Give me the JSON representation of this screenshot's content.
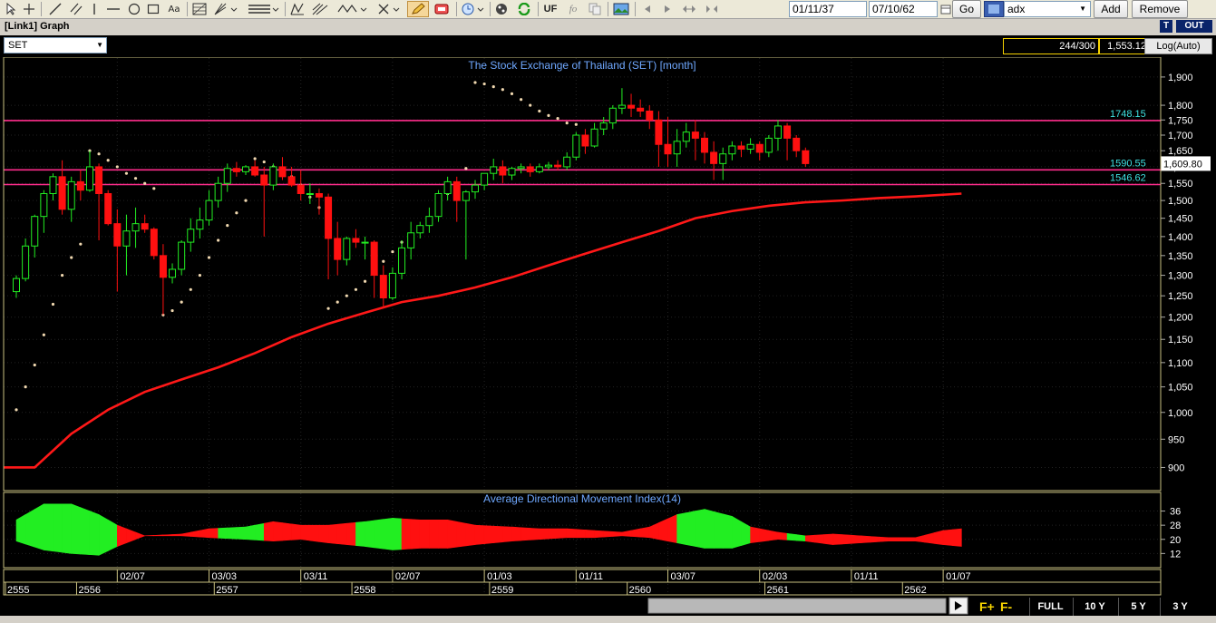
{
  "toolbar": {
    "icons": [
      "cursor-icon",
      "crosshair-icon",
      "trendline-icon",
      "parallel-lines-icon",
      "vertical-line-icon",
      "horizontal-line-icon",
      "circle-icon",
      "rectangle-icon",
      "text-tool-icon",
      "fibonacci-icon",
      "gann-icon",
      "zigzag-icon",
      "delete-icon",
      "pencil-icon",
      "eraser-icon",
      "clock-icon",
      "palette-icon",
      "refresh-icon",
      "formula-icon",
      "image-icon",
      "nav-left-icon",
      "nav-right-icon",
      "expand-icon",
      "shrink-icon"
    ],
    "uf_label": "UF",
    "fo_label": "fo",
    "start_date": "01/11/37",
    "end_date": "07/10/62",
    "go_label": "Go",
    "indicator_value": "adx",
    "add_label": "Add",
    "remove_label": "Remove"
  },
  "window": {
    "title": "[Link1] Graph",
    "t_label": "T",
    "out_label": "OUT"
  },
  "info": {
    "symbol": "SET",
    "count": "244/300",
    "price": "1,553.12",
    "scale_mode": "Log(Auto)"
  },
  "chart_data": {
    "type": "candlestick",
    "title": "The Stock Exchange of Thailand (SET) [month]",
    "yscale": "log",
    "ylim": [
      870,
      1960
    ],
    "y_ticks": [
      900,
      950,
      1000,
      1050,
      1100,
      1150,
      1200,
      1250,
      1300,
      1350,
      1400,
      1450,
      1500,
      1550,
      1600,
      1650,
      1700,
      1750,
      1800,
      1900
    ],
    "horizontal_lines": [
      {
        "value": 1748.15,
        "label": "1748.15",
        "color": "#ff2d8c"
      },
      {
        "value": 1590.55,
        "label": "1590.55",
        "color": "#ff2d8c"
      },
      {
        "value": 1546.62,
        "label": "1546.62",
        "color": "#ff2d8c"
      }
    ],
    "last_price_label": "1,609.80",
    "last_price_value": 1609.8,
    "x_month_labels": [
      "02/07",
      "03/03",
      "03/11",
      "02/07",
      "01/03",
      "01/11",
      "03/07",
      "02/03",
      "01/11",
      "01/07"
    ],
    "x_month_index": [
      11,
      21,
      31,
      41,
      51,
      61,
      71,
      81,
      91,
      101
    ],
    "x_year_labels": [
      "2555",
      "2556",
      "2557",
      "2558",
      "2559",
      "2560",
      "2561",
      "2562"
    ],
    "x_year_index": [
      0,
      4,
      19,
      34,
      49,
      64,
      79,
      94
    ],
    "candles": [
      {
        "o": 1260,
        "h": 1300,
        "l": 1245,
        "c": 1292
      },
      {
        "o": 1292,
        "h": 1395,
        "l": 1285,
        "c": 1375
      },
      {
        "o": 1375,
        "h": 1460,
        "l": 1345,
        "c": 1455
      },
      {
        "o": 1455,
        "h": 1530,
        "l": 1410,
        "c": 1520
      },
      {
        "o": 1520,
        "h": 1580,
        "l": 1500,
        "c": 1570
      },
      {
        "o": 1570,
        "h": 1620,
        "l": 1460,
        "c": 1475
      },
      {
        "o": 1475,
        "h": 1570,
        "l": 1440,
        "c": 1555
      },
      {
        "o": 1555,
        "h": 1590,
        "l": 1500,
        "c": 1530
      },
      {
        "o": 1530,
        "h": 1650,
        "l": 1525,
        "c": 1600
      },
      {
        "o": 1600,
        "h": 1610,
        "l": 1390,
        "c": 1520
      },
      {
        "o": 1520,
        "h": 1530,
        "l": 1430,
        "c": 1435
      },
      {
        "o": 1435,
        "h": 1475,
        "l": 1260,
        "c": 1375
      },
      {
        "o": 1375,
        "h": 1460,
        "l": 1300,
        "c": 1415
      },
      {
        "o": 1415,
        "h": 1480,
        "l": 1370,
        "c": 1435
      },
      {
        "o": 1435,
        "h": 1460,
        "l": 1410,
        "c": 1420
      },
      {
        "o": 1420,
        "h": 1425,
        "l": 1340,
        "c": 1350
      },
      {
        "o": 1350,
        "h": 1380,
        "l": 1205,
        "c": 1295
      },
      {
        "o": 1295,
        "h": 1330,
        "l": 1280,
        "c": 1315
      },
      {
        "o": 1315,
        "h": 1390,
        "l": 1300,
        "c": 1385
      },
      {
        "o": 1385,
        "h": 1450,
        "l": 1360,
        "c": 1420
      },
      {
        "o": 1420,
        "h": 1480,
        "l": 1395,
        "c": 1445
      },
      {
        "o": 1445,
        "h": 1530,
        "l": 1430,
        "c": 1500
      },
      {
        "o": 1500,
        "h": 1570,
        "l": 1480,
        "c": 1550
      },
      {
        "o": 1550,
        "h": 1610,
        "l": 1525,
        "c": 1595
      },
      {
        "o": 1595,
        "h": 1615,
        "l": 1570,
        "c": 1585
      },
      {
        "o": 1585,
        "h": 1605,
        "l": 1575,
        "c": 1600
      },
      {
        "o": 1600,
        "h": 1620,
        "l": 1570,
        "c": 1575
      },
      {
        "o": 1575,
        "h": 1600,
        "l": 1400,
        "c": 1545
      },
      {
        "o": 1545,
        "h": 1610,
        "l": 1530,
        "c": 1600
      },
      {
        "o": 1600,
        "h": 1630,
        "l": 1560,
        "c": 1570
      },
      {
        "o": 1570,
        "h": 1600,
        "l": 1540,
        "c": 1545
      },
      {
        "o": 1545,
        "h": 1590,
        "l": 1500,
        "c": 1520
      },
      {
        "o": 1520,
        "h": 1550,
        "l": 1490,
        "c": 1520
      },
      {
        "o": 1520,
        "h": 1535,
        "l": 1460,
        "c": 1510
      },
      {
        "o": 1510,
        "h": 1520,
        "l": 1290,
        "c": 1395
      },
      {
        "o": 1395,
        "h": 1440,
        "l": 1300,
        "c": 1340
      },
      {
        "o": 1340,
        "h": 1400,
        "l": 1325,
        "c": 1395
      },
      {
        "o": 1395,
        "h": 1420,
        "l": 1370,
        "c": 1385
      },
      {
        "o": 1385,
        "h": 1400,
        "l": 1340,
        "c": 1385
      },
      {
        "o": 1385,
        "h": 1390,
        "l": 1245,
        "c": 1300
      },
      {
        "o": 1300,
        "h": 1325,
        "l": 1220,
        "c": 1245
      },
      {
        "o": 1245,
        "h": 1320,
        "l": 1240,
        "c": 1305
      },
      {
        "o": 1305,
        "h": 1390,
        "l": 1290,
        "c": 1370
      },
      {
        "o": 1370,
        "h": 1440,
        "l": 1340,
        "c": 1410
      },
      {
        "o": 1410,
        "h": 1440,
        "l": 1395,
        "c": 1430
      },
      {
        "o": 1430,
        "h": 1480,
        "l": 1410,
        "c": 1455
      },
      {
        "o": 1455,
        "h": 1530,
        "l": 1440,
        "c": 1520
      },
      {
        "o": 1520,
        "h": 1570,
        "l": 1500,
        "c": 1555
      },
      {
        "o": 1555,
        "h": 1570,
        "l": 1440,
        "c": 1500
      },
      {
        "o": 1500,
        "h": 1530,
        "l": 1340,
        "c": 1525
      },
      {
        "o": 1525,
        "h": 1560,
        "l": 1505,
        "c": 1545
      },
      {
        "o": 1545,
        "h": 1580,
        "l": 1530,
        "c": 1580
      },
      {
        "o": 1580,
        "h": 1625,
        "l": 1560,
        "c": 1600
      },
      {
        "o": 1600,
        "h": 1620,
        "l": 1550,
        "c": 1575
      },
      {
        "o": 1575,
        "h": 1600,
        "l": 1560,
        "c": 1595
      },
      {
        "o": 1595,
        "h": 1610,
        "l": 1580,
        "c": 1600
      },
      {
        "o": 1600,
        "h": 1610,
        "l": 1570,
        "c": 1585
      },
      {
        "o": 1585,
        "h": 1610,
        "l": 1580,
        "c": 1600
      },
      {
        "o": 1600,
        "h": 1615,
        "l": 1590,
        "c": 1605
      },
      {
        "o": 1605,
        "h": 1620,
        "l": 1590,
        "c": 1600
      },
      {
        "o": 1600,
        "h": 1645,
        "l": 1590,
        "c": 1630
      },
      {
        "o": 1630,
        "h": 1710,
        "l": 1620,
        "c": 1700
      },
      {
        "o": 1700,
        "h": 1720,
        "l": 1640,
        "c": 1665
      },
      {
        "o": 1665,
        "h": 1740,
        "l": 1660,
        "c": 1720
      },
      {
        "o": 1720,
        "h": 1760,
        "l": 1700,
        "c": 1740
      },
      {
        "o": 1740,
        "h": 1800,
        "l": 1720,
        "c": 1790
      },
      {
        "o": 1790,
        "h": 1860,
        "l": 1770,
        "c": 1800
      },
      {
        "o": 1800,
        "h": 1840,
        "l": 1760,
        "c": 1790
      },
      {
        "o": 1790,
        "h": 1820,
        "l": 1760,
        "c": 1780
      },
      {
        "o": 1780,
        "h": 1800,
        "l": 1720,
        "c": 1750
      },
      {
        "o": 1750,
        "h": 1780,
        "l": 1600,
        "c": 1670
      },
      {
        "o": 1670,
        "h": 1760,
        "l": 1600,
        "c": 1640
      },
      {
        "o": 1640,
        "h": 1720,
        "l": 1600,
        "c": 1680
      },
      {
        "o": 1680,
        "h": 1740,
        "l": 1660,
        "c": 1710
      },
      {
        "o": 1710,
        "h": 1750,
        "l": 1620,
        "c": 1690
      },
      {
        "o": 1690,
        "h": 1710,
        "l": 1610,
        "c": 1645
      },
      {
        "o": 1645,
        "h": 1680,
        "l": 1560,
        "c": 1610
      },
      {
        "o": 1610,
        "h": 1660,
        "l": 1560,
        "c": 1640
      },
      {
        "o": 1640,
        "h": 1680,
        "l": 1620,
        "c": 1665
      },
      {
        "o": 1665,
        "h": 1680,
        "l": 1630,
        "c": 1655
      },
      {
        "o": 1655,
        "h": 1690,
        "l": 1640,
        "c": 1670
      },
      {
        "o": 1670,
        "h": 1680,
        "l": 1620,
        "c": 1645
      },
      {
        "o": 1645,
        "h": 1700,
        "l": 1630,
        "c": 1690
      },
      {
        "o": 1690,
        "h": 1750,
        "l": 1650,
        "c": 1730
      },
      {
        "o": 1730,
        "h": 1740,
        "l": 1620,
        "c": 1690
      },
      {
        "o": 1690,
        "h": 1700,
        "l": 1630,
        "c": 1650
      },
      {
        "o": 1650,
        "h": 1660,
        "l": 1600,
        "c": 1609.8
      }
    ],
    "sar_points": [
      {
        "i": 0,
        "v": 1005
      },
      {
        "i": 1,
        "v": 1050
      },
      {
        "i": 2,
        "v": 1095
      },
      {
        "i": 3,
        "v": 1160
      },
      {
        "i": 4,
        "v": 1230
      },
      {
        "i": 5,
        "v": 1300
      },
      {
        "i": 6,
        "v": 1345
      },
      {
        "i": 7,
        "v": 1380
      },
      {
        "i": 8,
        "v": 1650
      },
      {
        "i": 9,
        "v": 1640
      },
      {
        "i": 10,
        "v": 1620
      },
      {
        "i": 11,
        "v": 1600
      },
      {
        "i": 12,
        "v": 1580
      },
      {
        "i": 13,
        "v": 1565
      },
      {
        "i": 14,
        "v": 1550
      },
      {
        "i": 15,
        "v": 1535
      },
      {
        "i": 16,
        "v": 1205
      },
      {
        "i": 17,
        "v": 1215
      },
      {
        "i": 18,
        "v": 1235
      },
      {
        "i": 19,
        "v": 1265
      },
      {
        "i": 20,
        "v": 1300
      },
      {
        "i": 21,
        "v": 1345
      },
      {
        "i": 22,
        "v": 1390
      },
      {
        "i": 23,
        "v": 1430
      },
      {
        "i": 24,
        "v": 1465
      },
      {
        "i": 25,
        "v": 1500
      },
      {
        "i": 26,
        "v": 1625
      },
      {
        "i": 27,
        "v": 1615
      },
      {
        "i": 28,
        "v": 1600
      },
      {
        "i": 29,
        "v": 1585
      },
      {
        "i": 30,
        "v": 1570
      },
      {
        "i": 31,
        "v": 1545
      },
      {
        "i": 32,
        "v": 1510
      },
      {
        "i": 33,
        "v": 1480
      },
      {
        "i": 34,
        "v": 1220
      },
      {
        "i": 35,
        "v": 1235
      },
      {
        "i": 36,
        "v": 1250
      },
      {
        "i": 37,
        "v": 1265
      },
      {
        "i": 38,
        "v": 1285
      },
      {
        "i": 39,
        "v": 1310
      },
      {
        "i": 40,
        "v": 1335
      },
      {
        "i": 41,
        "v": 1360
      },
      {
        "i": 42,
        "v": 1385
      },
      {
        "i": 43,
        "v": 1400
      },
      {
        "i": 44,
        "v": 1420
      },
      {
        "i": 45,
        "v": 1450
      },
      {
        "i": 46,
        "v": 1480
      },
      {
        "i": 47,
        "v": 1520
      },
      {
        "i": 48,
        "v": 1540
      },
      {
        "i": 49,
        "v": 1595
      },
      {
        "i": 50,
        "v": 1880
      },
      {
        "i": 51,
        "v": 1875
      },
      {
        "i": 52,
        "v": 1865
      },
      {
        "i": 53,
        "v": 1855
      },
      {
        "i": 54,
        "v": 1840
      },
      {
        "i": 55,
        "v": 1820
      },
      {
        "i": 56,
        "v": 1800
      },
      {
        "i": 57,
        "v": 1780
      },
      {
        "i": 58,
        "v": 1765
      },
      {
        "i": 59,
        "v": 1755
      },
      {
        "i": 60,
        "v": 1740
      },
      {
        "i": 61,
        "v": 1735
      }
    ],
    "ma_line": [
      {
        "i": 0,
        "v": 900
      },
      {
        "i": 2,
        "v": 900
      },
      {
        "i": 6,
        "v": 960
      },
      {
        "i": 10,
        "v": 1005
      },
      {
        "i": 14,
        "v": 1040
      },
      {
        "i": 18,
        "v": 1065
      },
      {
        "i": 22,
        "v": 1090
      },
      {
        "i": 26,
        "v": 1120
      },
      {
        "i": 30,
        "v": 1155
      },
      {
        "i": 34,
        "v": 1185
      },
      {
        "i": 38,
        "v": 1210
      },
      {
        "i": 42,
        "v": 1235
      },
      {
        "i": 46,
        "v": 1250
      },
      {
        "i": 50,
        "v": 1270
      },
      {
        "i": 54,
        "v": 1295
      },
      {
        "i": 58,
        "v": 1325
      },
      {
        "i": 62,
        "v": 1355
      },
      {
        "i": 66,
        "v": 1385
      },
      {
        "i": 70,
        "v": 1415
      },
      {
        "i": 74,
        "v": 1450
      },
      {
        "i": 78,
        "v": 1470
      },
      {
        "i": 82,
        "v": 1485
      },
      {
        "i": 86,
        "v": 1495
      },
      {
        "i": 90,
        "v": 1500
      },
      {
        "i": 94,
        "v": 1507
      },
      {
        "i": 98,
        "v": 1512
      },
      {
        "i": 103,
        "v": 1520
      }
    ],
    "adx": {
      "title": "Average Directional Movement Index(14)",
      "ylim": [
        5,
        45
      ],
      "y_ticks": [
        12,
        20,
        28,
        36
      ],
      "positive_color": "#22ee22",
      "negative_color": "#ff1010",
      "upper": [
        {
          "i": 0,
          "v": 31
        },
        {
          "i": 3,
          "v": 40
        },
        {
          "i": 6,
          "v": 40
        },
        {
          "i": 9,
          "v": 34
        },
        {
          "i": 11,
          "v": 28
        },
        {
          "i": 14,
          "v": 22
        },
        {
          "i": 18,
          "v": 23
        },
        {
          "i": 21,
          "v": 26
        },
        {
          "i": 25,
          "v": 27
        },
        {
          "i": 28,
          "v": 30
        },
        {
          "i": 31,
          "v": 28
        },
        {
          "i": 34,
          "v": 28
        },
        {
          "i": 38,
          "v": 30
        },
        {
          "i": 41,
          "v": 32
        },
        {
          "i": 44,
          "v": 31
        },
        {
          "i": 47,
          "v": 31
        },
        {
          "i": 50,
          "v": 28
        },
        {
          "i": 54,
          "v": 27
        },
        {
          "i": 57,
          "v": 26
        },
        {
          "i": 60,
          "v": 26
        },
        {
          "i": 63,
          "v": 25
        },
        {
          "i": 66,
          "v": 24
        },
        {
          "i": 69,
          "v": 27
        },
        {
          "i": 72,
          "v": 34
        },
        {
          "i": 75,
          "v": 37
        },
        {
          "i": 78,
          "v": 33
        },
        {
          "i": 80,
          "v": 27
        },
        {
          "i": 83,
          "v": 24
        },
        {
          "i": 86,
          "v": 22
        },
        {
          "i": 89,
          "v": 23
        },
        {
          "i": 92,
          "v": 22
        },
        {
          "i": 95,
          "v": 21
        },
        {
          "i": 98,
          "v": 21
        },
        {
          "i": 101,
          "v": 25
        },
        {
          "i": 103,
          "v": 26
        }
      ],
      "lower": [
        {
          "i": 0,
          "v": 19
        },
        {
          "i": 3,
          "v": 14
        },
        {
          "i": 6,
          "v": 12
        },
        {
          "i": 9,
          "v": 11
        },
        {
          "i": 11,
          "v": 16
        },
        {
          "i": 14,
          "v": 22
        },
        {
          "i": 18,
          "v": 22
        },
        {
          "i": 21,
          "v": 21
        },
        {
          "i": 25,
          "v": 20
        },
        {
          "i": 28,
          "v": 19
        },
        {
          "i": 31,
          "v": 20
        },
        {
          "i": 34,
          "v": 18
        },
        {
          "i": 38,
          "v": 16
        },
        {
          "i": 41,
          "v": 14
        },
        {
          "i": 44,
          "v": 15
        },
        {
          "i": 47,
          "v": 15
        },
        {
          "i": 50,
          "v": 17
        },
        {
          "i": 54,
          "v": 19
        },
        {
          "i": 57,
          "v": 20
        },
        {
          "i": 60,
          "v": 21
        },
        {
          "i": 63,
          "v": 21
        },
        {
          "i": 66,
          "v": 22
        },
        {
          "i": 69,
          "v": 21
        },
        {
          "i": 72,
          "v": 18
        },
        {
          "i": 75,
          "v": 15
        },
        {
          "i": 78,
          "v": 15
        },
        {
          "i": 80,
          "v": 18
        },
        {
          "i": 83,
          "v": 20
        },
        {
          "i": 86,
          "v": 19
        },
        {
          "i": 89,
          "v": 17
        },
        {
          "i": 92,
          "v": 18
        },
        {
          "i": 95,
          "v": 19
        },
        {
          "i": 98,
          "v": 19
        },
        {
          "i": 101,
          "v": 17
        },
        {
          "i": 103,
          "v": 16
        }
      ],
      "green_ranges": [
        [
          0,
          11
        ],
        [
          22,
          27
        ],
        [
          37,
          42
        ],
        [
          72,
          80
        ],
        [
          84,
          86
        ]
      ]
    }
  },
  "ranges": {
    "full": "FULL",
    "y10": "10 Y",
    "y5": "5 Y",
    "y3": "3 Y"
  }
}
